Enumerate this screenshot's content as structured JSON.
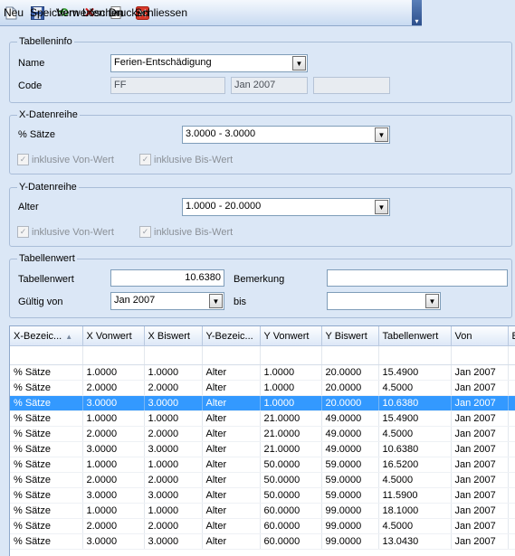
{
  "toolbar": {
    "new": "Neu",
    "save": "Speichern",
    "discard": "Verwerfen",
    "delete": "Löschen",
    "print": "Drucken",
    "close": "Schliessen"
  },
  "tabelleninfo": {
    "legend": "Tabelleninfo",
    "name_label": "Name",
    "name_value": "Ferien-Entschädigung",
    "code_label": "Code",
    "code_value": "FF",
    "date_value": "Jan 2007",
    "extra_value": ""
  },
  "x_series": {
    "legend": "X-Datenreihe",
    "label": "% Sätze",
    "value": "3.0000 - 3.0000",
    "incl_from": "inklusive Von-Wert",
    "incl_to": "inklusive Bis-Wert"
  },
  "y_series": {
    "legend": "Y-Datenreihe",
    "label": "Alter",
    "value": "1.0000 - 20.0000",
    "incl_from": "inklusive Von-Wert",
    "incl_to": "inklusive Bis-Wert"
  },
  "tabellenwert": {
    "legend": "Tabellenwert",
    "value_label": "Tabellenwert",
    "value": "10.6380",
    "remark_label": "Bemerkung",
    "remark_value": "",
    "valid_from_label": "Gültig von",
    "valid_from": "Jan 2007",
    "to_label": "bis",
    "to_value": ""
  },
  "grid": {
    "columns": [
      "X-Bezeic...",
      "X Vonwert",
      "X Biswert",
      "Y-Bezeic...",
      "Y Vonwert",
      "Y Biswert",
      "Tabellenwert",
      "Von",
      "Bi"
    ],
    "selected_index": 2,
    "rows": [
      [
        "% Sätze",
        "1.0000",
        "1.0000",
        "Alter",
        "1.0000",
        "20.0000",
        "15.4900",
        "Jan 2007",
        ""
      ],
      [
        "% Sätze",
        "2.0000",
        "2.0000",
        "Alter",
        "1.0000",
        "20.0000",
        "4.5000",
        "Jan 2007",
        ""
      ],
      [
        "% Sätze",
        "3.0000",
        "3.0000",
        "Alter",
        "1.0000",
        "20.0000",
        "10.6380",
        "Jan 2007",
        ""
      ],
      [
        "% Sätze",
        "1.0000",
        "1.0000",
        "Alter",
        "21.0000",
        "49.0000",
        "15.4900",
        "Jan 2007",
        ""
      ],
      [
        "% Sätze",
        "2.0000",
        "2.0000",
        "Alter",
        "21.0000",
        "49.0000",
        "4.5000",
        "Jan 2007",
        ""
      ],
      [
        "% Sätze",
        "3.0000",
        "3.0000",
        "Alter",
        "21.0000",
        "49.0000",
        "10.6380",
        "Jan 2007",
        ""
      ],
      [
        "% Sätze",
        "1.0000",
        "1.0000",
        "Alter",
        "50.0000",
        "59.0000",
        "16.5200",
        "Jan 2007",
        ""
      ],
      [
        "% Sätze",
        "2.0000",
        "2.0000",
        "Alter",
        "50.0000",
        "59.0000",
        "4.5000",
        "Jan 2007",
        ""
      ],
      [
        "% Sätze",
        "3.0000",
        "3.0000",
        "Alter",
        "50.0000",
        "59.0000",
        "11.5900",
        "Jan 2007",
        ""
      ],
      [
        "% Sätze",
        "1.0000",
        "1.0000",
        "Alter",
        "60.0000",
        "99.0000",
        "18.1000",
        "Jan 2007",
        ""
      ],
      [
        "% Sätze",
        "2.0000",
        "2.0000",
        "Alter",
        "60.0000",
        "99.0000",
        "4.5000",
        "Jan 2007",
        ""
      ],
      [
        "% Sätze",
        "3.0000",
        "3.0000",
        "Alter",
        "60.0000",
        "99.0000",
        "13.0430",
        "Jan 2007",
        ""
      ]
    ]
  },
  "colors": {
    "selection": "#3399ff",
    "background": "#dbe7f6"
  }
}
